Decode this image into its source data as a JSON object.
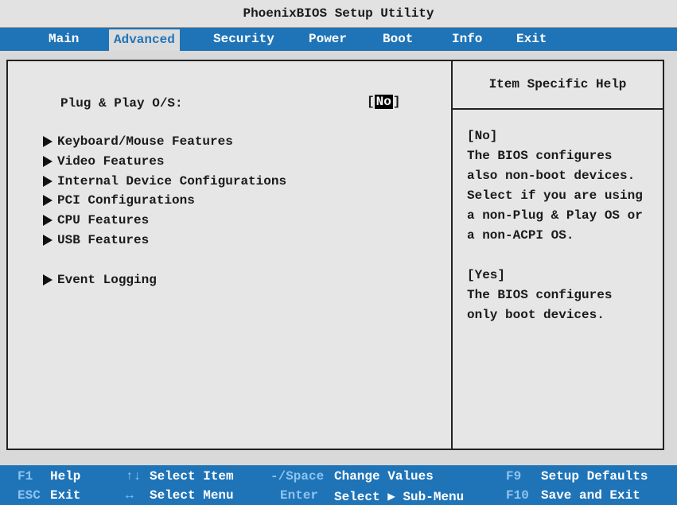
{
  "title": "PhoenixBIOS Setup Utility",
  "menu": [
    "Main",
    "Advanced",
    "Security",
    "Power",
    "Boot",
    "Info",
    "Exit"
  ],
  "active_menu": "Advanced",
  "setting": {
    "label": "Plug & Play O/S:",
    "value_open": "[",
    "value": "No",
    "value_close": "]"
  },
  "submenus": [
    "Keyboard/Mouse Features",
    "Video Features",
    "Internal Device Configurations",
    "PCI Configurations",
    "CPU Features",
    "USB Features",
    "Event Logging"
  ],
  "help": {
    "title": "Item Specific Help",
    "lines": [
      "[No]",
      "The BIOS configures",
      "also non-boot devices.",
      "Select if you are using",
      "a non-Plug & Play OS or",
      "a non-ACPI OS.",
      "[Yes]",
      "The BIOS configures",
      "only boot devices."
    ]
  },
  "footer": {
    "row1": [
      {
        "key": "F1",
        "desc": "Help"
      },
      {
        "key": "↑↓",
        "desc": "Select Item"
      },
      {
        "key": "-/Space",
        "desc": "Change Values"
      },
      {
        "key": "F9",
        "desc": "Setup Defaults"
      }
    ],
    "row2": [
      {
        "key": "ESC",
        "desc": "Exit"
      },
      {
        "key": "↔",
        "desc": "Select Menu"
      },
      {
        "key": "Enter",
        "desc": "Select ▶ Sub-Menu"
      },
      {
        "key": "F10",
        "desc": "Save and Exit"
      }
    ]
  }
}
